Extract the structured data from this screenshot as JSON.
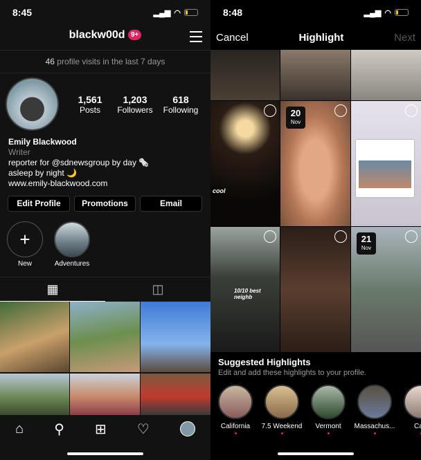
{
  "left": {
    "status": {
      "time": "8:45"
    },
    "header": {
      "username": "blackw00d",
      "badge": "9+"
    },
    "visits": {
      "count": "46",
      "text": " profile visits in the last 7 days"
    },
    "stats": [
      {
        "value": "1,561",
        "label": "Posts"
      },
      {
        "value": "1,203",
        "label": "Followers"
      },
      {
        "value": "618",
        "label": "Following"
      }
    ],
    "bio": {
      "name": "Emily Blackwood",
      "category": "Writer",
      "line1": "reporter for @sdnewsgroup by day 🗞️",
      "line2": "asleep by night 🌙",
      "link": "www.emily-blackwood.com"
    },
    "buttons": {
      "edit": "Edit Profile",
      "promotions": "Promotions",
      "email": "Email"
    },
    "highlights": [
      {
        "label": "New",
        "icon": "plus-icon"
      },
      {
        "label": "Adventures"
      }
    ],
    "tabs": [
      {
        "icon": "grid-icon"
      },
      {
        "icon": "tagged-icon"
      }
    ],
    "nav": [
      "home-icon",
      "search-icon",
      "add-icon",
      "heart-icon",
      "profile-icon"
    ]
  },
  "right": {
    "status": {
      "time": "8:48"
    },
    "header": {
      "cancel": "Cancel",
      "title": "Highlight",
      "next": "Next"
    },
    "stories": [
      {
        "date_day": "20",
        "date_month": "Nov"
      },
      {
        "date_day": "21",
        "date_month": "Nov"
      }
    ],
    "captions": {
      "cool": "cool",
      "neighb": "10/10 best neighb"
    },
    "suggested": {
      "title": "Suggested Highlights",
      "subtitle": "Edit and add these highlights to your profile.",
      "items": [
        "California",
        "7.5 Weekend",
        "Vermont",
        "Massachus...",
        "Calif"
      ]
    }
  },
  "colors": {
    "badge": "#e0245e",
    "background": "#121212"
  }
}
